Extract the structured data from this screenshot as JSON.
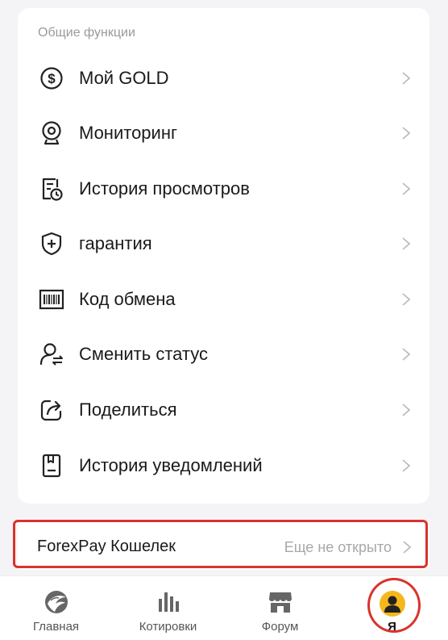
{
  "section": {
    "title": "Общие функции"
  },
  "menu": {
    "items": [
      {
        "label": "Мой GOLD",
        "icon": "dollar-coin-icon"
      },
      {
        "label": "Мониторинг",
        "icon": "webcam-icon"
      },
      {
        "label": "История просмотров",
        "icon": "history-document-icon"
      },
      {
        "label": "гарантия",
        "icon": "shield-plus-icon"
      },
      {
        "label": "Код обмена",
        "icon": "barcode-icon"
      },
      {
        "label": "Сменить статус",
        "icon": "user-switch-icon"
      },
      {
        "label": "Поделиться",
        "icon": "share-icon"
      },
      {
        "label": "История уведомлений",
        "icon": "notification-history-icon"
      }
    ]
  },
  "wallet": {
    "label": "ForexPay Кошелек",
    "status": "Еще не открыто"
  },
  "tabbar": {
    "tabs": [
      {
        "label": "Главная",
        "icon": "home-logo-icon"
      },
      {
        "label": "Котировки",
        "icon": "bar-chart-icon"
      },
      {
        "label": "Форум",
        "icon": "store-icon"
      },
      {
        "label": "Я",
        "icon": "avatar-icon"
      }
    ],
    "active": "Я"
  },
  "colors": {
    "highlight": "#d9332b",
    "avatar_bg": "#f5b81c",
    "icon_stroke": "#222222",
    "muted_text": "#a8a8a8"
  }
}
